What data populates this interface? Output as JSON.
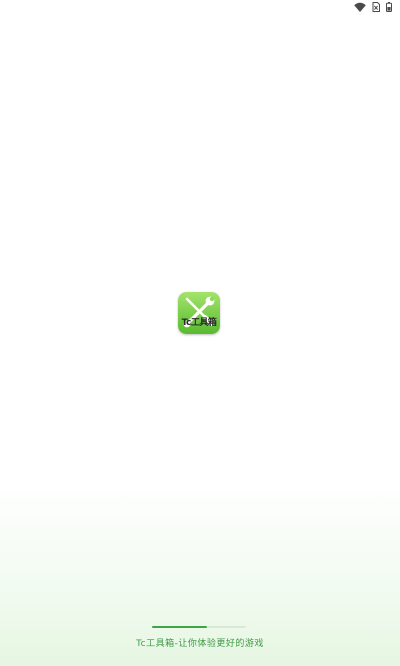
{
  "status_bar": {
    "icons": [
      "wifi-icon",
      "no-sim-icon",
      "battery-icon"
    ]
  },
  "splash": {
    "icon_name": "wrench-screwdriver-icon",
    "icon_label": "Tc工具箱",
    "progress": 0.58
  },
  "tagline": "Tc工具箱-让你体验更好的游戏",
  "colors": {
    "accent": "#3da447",
    "icon_top": "#a3e36c",
    "icon_bottom": "#59bb2f",
    "tagline": "#3e9a46",
    "status": "#4a4a4a"
  }
}
